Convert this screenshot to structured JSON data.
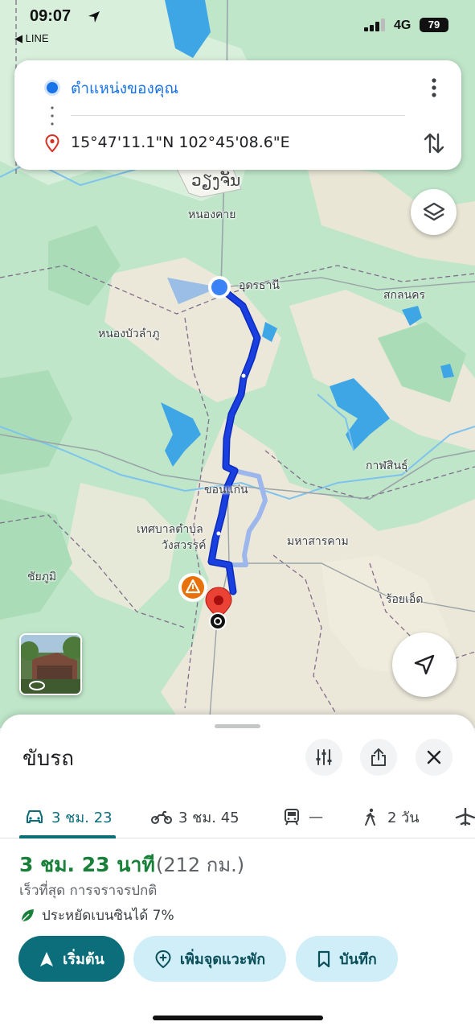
{
  "status_bar": {
    "time": "09:07",
    "back_app": "◀ LINE",
    "network": "4G",
    "battery": "79"
  },
  "directions": {
    "origin": "ตำแหน่งของคุณ",
    "destination": "15°47'11.1\"N 102°45'08.6\"E",
    "icons": [
      "blue-dot-icon",
      "red-pin-icon",
      "more-vert-icon",
      "swap-icon"
    ]
  },
  "map": {
    "places": {
      "vientiane": "ວຽງຈັນ",
      "nong_khai": "หนองคาย",
      "udon_thani": "อุดรธานี",
      "sakon_nakhon": "สกลนคร",
      "nong_bua_lamphu": "หนองบัวลำภู",
      "kalasin": "กาฬสินธุ์",
      "khon_kaen": "ขอนแก่น",
      "wang_sawan_1": "เทศบาลตำบล",
      "wang_sawan_2": "วังสวรรค์",
      "maha_sarakham": "มหาสารคาม",
      "chaiyaphum": "ชัยภูมิ",
      "roi_et": "ร้อยเอ็ด"
    },
    "colors": {
      "route": "#1a3fe0",
      "alt_route": "#9db7ec",
      "water": "#3fa6e6",
      "land_light": "#ebe8da",
      "land_green": "#bfe6c9"
    }
  },
  "sheet": {
    "mode_title": "ขับรถ",
    "tabs": [
      {
        "label": "3 ชม. 23",
        "icon": "car-icon"
      },
      {
        "label": "3 ชม. 45",
        "icon": "motorbike-icon"
      },
      {
        "label": "—",
        "icon": "train-icon"
      },
      {
        "label": "2 วัน",
        "icon": "walk-icon"
      },
      {
        "label": "",
        "icon": "plane-icon"
      }
    ],
    "duration": "3 ชม. 23 นาที",
    "distance": "(212 กม.)",
    "route_note": "เร็วที่สุด การจราจรปกติ",
    "eco_note": "ประหยัดเบนซินได้ 7%",
    "buttons": {
      "start": "เริ่มต้น",
      "add_stop": "เพิ่มจุดแวะพัก",
      "save": "บันทึก"
    }
  }
}
